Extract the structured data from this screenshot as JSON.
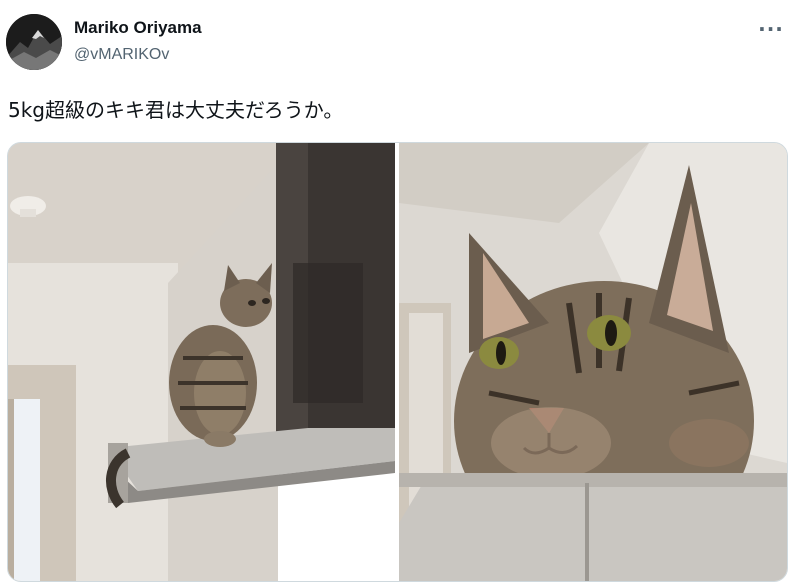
{
  "author": {
    "display_name": "Mariko Oriyama",
    "handle": "@vMARIKOv",
    "avatar_icon": "mountain-avatar-icon"
  },
  "menu": {
    "more_label": "···",
    "icon": "more-options-icon"
  },
  "tweet": {
    "text": "5kg超級のキキ君は大丈夫だろうか。"
  },
  "media": {
    "count": 2,
    "items": [
      {
        "subject": "cat-on-range-hood-photo"
      },
      {
        "subject": "cat-closeup-photo"
      }
    ]
  },
  "colors": {
    "name": "#0f1419",
    "handle": "#536471",
    "border": "#cfd9de"
  }
}
